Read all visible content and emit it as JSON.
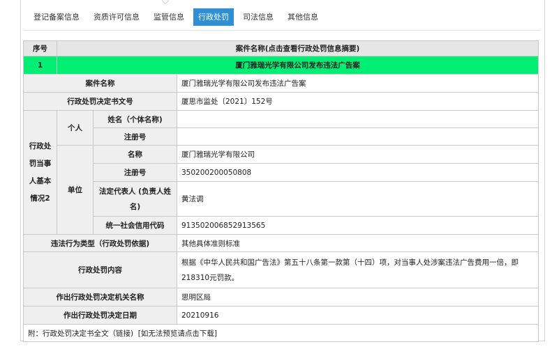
{
  "tabs": [
    {
      "label": "登记备案信息",
      "active": false
    },
    {
      "label": "资质许可信息",
      "active": false
    },
    {
      "label": "监管信息",
      "active": false
    },
    {
      "label": "行政处罚",
      "active": true
    },
    {
      "label": "司法信息",
      "active": false
    },
    {
      "label": "其他信息",
      "active": false
    }
  ],
  "table": {
    "header": {
      "index": "序号",
      "name": "案件名称(点击查看行政处罚信息摘要)"
    },
    "case_index": "1",
    "case_title": "厦门雅瑞光学有限公司发布违法广告案",
    "rows": {
      "case_name": {
        "label": "案件名称",
        "value": "厦门雅瑞光学有限公司发布违法广告案"
      },
      "decision_no": {
        "label": "行政处罚决定书文号",
        "value": "厦思市监处〔2021〕152号"
      },
      "party_group_label": "行政处罚当事人基本情况2",
      "individual": {
        "label": "个人",
        "name_label": "姓名（个体名称)",
        "name_value": "",
        "reg_label": "注册号",
        "reg_value": ""
      },
      "entity": {
        "label": "单位",
        "name_label": "名称",
        "name_value": "厦门雅瑞光学有限公司",
        "reg_label": "注册号",
        "reg_value": "350200200050808",
        "legal_label": "法定代表人\n(负责人姓名)",
        "legal_value": "黄法调",
        "credit_label": "统一社会信用代码",
        "credit_value": "913502006852913565"
      },
      "violation_type": {
        "label": "违法行为类型（行政处罚依据)",
        "value": "其他具体准则标准"
      },
      "penalty_content": {
        "label": "行政处罚内容",
        "value": "根据《中华人民共和国广告法》第五十八条第一款第（十四）项，对当事人处涉案违法广告费用一倍，即 218310元罚款。"
      },
      "authority": {
        "label": "作出行政处罚决定机关名称",
        "value": "思明区局"
      },
      "decision_date": {
        "label": "作出行政处罚决定日期",
        "value": "20210916"
      }
    },
    "footer": {
      "prefix": "附：",
      "full_text_link": "行政处罚决定书全文（链接)",
      "download_link": "[如无法预览请点击下载]"
    }
  },
  "colors": {
    "active_tab": "#2f8fd5",
    "highlight_row": "#00ee74",
    "footer_link": "#1a4fa0"
  }
}
